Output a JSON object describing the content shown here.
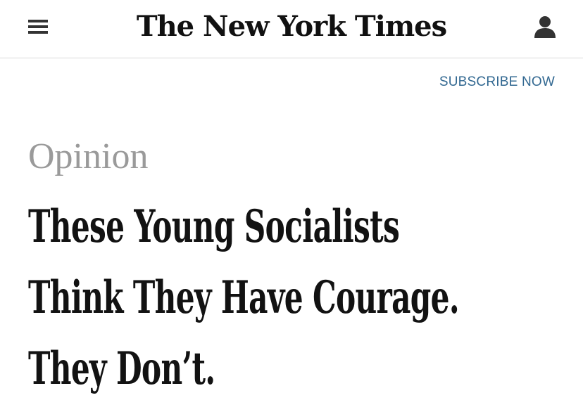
{
  "header": {
    "logo_text": "The New York Times",
    "menu_icon": "hamburger-menu-icon",
    "account_icon": "user-account-icon"
  },
  "subscribe": {
    "label": "SUBSCRIBE NOW"
  },
  "article": {
    "kicker": "Opinion",
    "headline_lines": [
      "These Young Socialists",
      "Think They Have Courage.",
      "They Don’t."
    ]
  },
  "colors": {
    "link": "#326891",
    "kicker": "#9a9a9a",
    "text": "#121212",
    "divider": "#d9d9d9"
  }
}
